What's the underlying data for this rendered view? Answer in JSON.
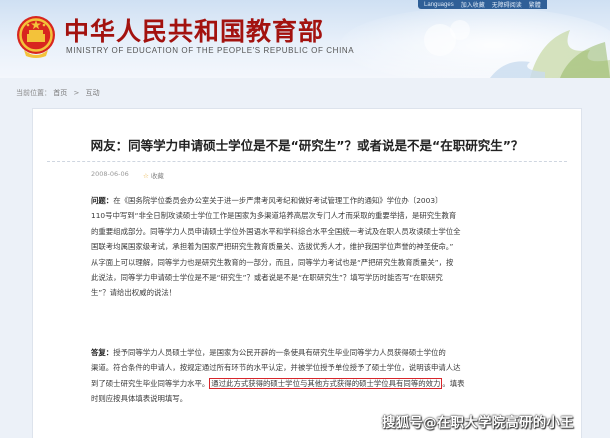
{
  "header": {
    "title": "中华人民共和国教育部",
    "subtitle": "MINISTRY OF EDUCATION OF THE PEOPLE'S REPUBLIC OF CHINA",
    "links": [
      "Languages",
      "加入收藏",
      "无障碍阅读",
      "繁體"
    ]
  },
  "breadcrumb": {
    "label": "当前位置：",
    "items": [
      "首页",
      "互动"
    ]
  },
  "article": {
    "title": "网友：同等学力申请硕士学位是不是“研究生”？或者说是不是“在职研究生”？",
    "date": "2008-06-06",
    "favorite": "收藏",
    "question_label": "问题：",
    "question_lines": [
      "在《国务院学位委员会办公室关于进一步严肃考风考纪和做好考试管理工作的通知》学位办〔2003〕",
      "110号中写到“非全日制攻读硕士学位工作是国家为多渠道培养高层次专门人才而采取的重要举措，是研究生教育",
      "的重要组成部分。同等学力人员申请硕士学位外国语水平和学科综合水平全国统一考试及在职人员攻读硕士学位全",
      "国联考均属国家级考试，承担着为国家严把研究生教育质量关、选拔优秀人才，维护我国学位声誉的神圣使命。”",
      "从字面上可以理解，同等学力也是研究生教育的一部分，而且，同等学力考试也是“严把研究生教育质量关”，按",
      "此说法，同等学力申请硕士学位是不是“研究生”？或者说是不是“在职研究生”？填写学历时能否写“在职研究",
      "生”？请给出权威的说法！"
    ],
    "answer_label": "答复：",
    "answer_line1": "授予同等学力人员硕士学位，是国家为公民开辟的一条使具有研究生毕业同等学力人员获得硕士学位的",
    "answer_line2": "渠道。符合条件的申请人，按规定通过所有环节的水平认定，并被学位授予单位授予了硕士学位，说明该申请人达",
    "answer_line3_pre": "到了硕士研究生毕业同等学力水平。",
    "answer_line3_highlight": "通过此方式获得的硕士学位与其他方式获得的硕士学位具有同等的效力",
    "answer_line3_post": "。填表",
    "answer_line4": "时则应按具体填表说明填写。"
  },
  "watermark": "搜狐号@在职大学院高研的小王",
  "colors": {
    "title_red": "#a3120f",
    "highlight_border": "#d7262b",
    "header_blue": "#cfe0f3"
  }
}
